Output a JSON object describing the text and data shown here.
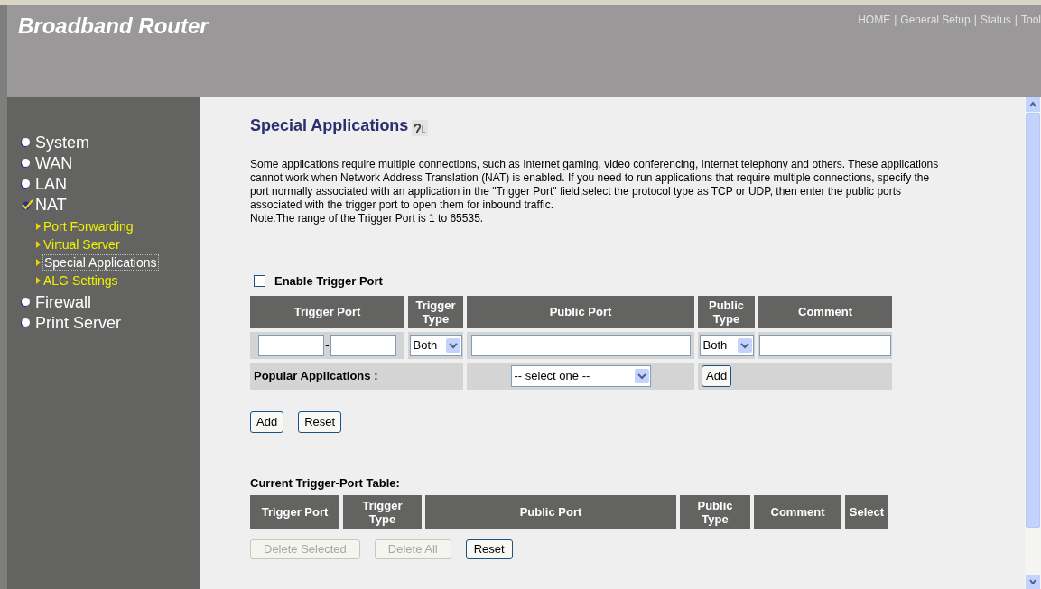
{
  "header": {
    "title": "Broadband Router",
    "nav": [
      "HOME",
      "General Setup",
      "Status",
      "Tool"
    ],
    "nav_separators": [
      "|",
      "|",
      "|"
    ]
  },
  "sidebar": {
    "items": [
      {
        "label": "System",
        "selected": false
      },
      {
        "label": "WAN",
        "selected": false
      },
      {
        "label": "LAN",
        "selected": false
      },
      {
        "label": "NAT",
        "selected": true,
        "children": [
          {
            "label": "Port Forwarding",
            "selected": false
          },
          {
            "label": "Virtual Server",
            "selected": false
          },
          {
            "label": "Special Applications",
            "selected": true
          },
          {
            "label": "ALG Settings",
            "selected": false
          }
        ]
      },
      {
        "label": "Firewall",
        "selected": false
      },
      {
        "label": "Print Server",
        "selected": false
      }
    ]
  },
  "page": {
    "title": "Special Applications",
    "description": "Some applications require multiple connections, such as Internet gaming, video conferencing, Internet telephony and others. These applications cannot work when Network Address Translation (NAT) is enabled. If you need to run applications that require multiple connections, specify the port normally associated with an application in the \"Trigger Port\" field,select the protocol type as TCP or UDP, then enter the public ports associated with the trigger port to open them for inbound traffic.",
    "note": "Note:The range of the Trigger Port is 1 to 65535."
  },
  "trigger_form": {
    "enable": {
      "label": "Enable Trigger Port",
      "checked": false
    },
    "columns": [
      "Trigger Port",
      "Trigger Type",
      "Public Port",
      "Public Type",
      "Comment"
    ],
    "row": {
      "range_separator": "-",
      "trigger_type": "Both",
      "public_type": "Both"
    },
    "popular": {
      "label": "Popular Applications :",
      "select": "-- select one --",
      "button": "Add"
    },
    "buttons": [
      "Add",
      "Reset"
    ]
  },
  "current_table": {
    "title": "Current Trigger-Port Table:",
    "columns": [
      "Trigger Port",
      "Trigger Type",
      "Public Port",
      "Public Type",
      "Comment",
      "Select"
    ],
    "buttons": [
      {
        "label": "Delete Selected",
        "disabled": true
      },
      {
        "label": "Delete All",
        "disabled": true
      },
      {
        "label": "Reset",
        "disabled": false
      }
    ]
  }
}
